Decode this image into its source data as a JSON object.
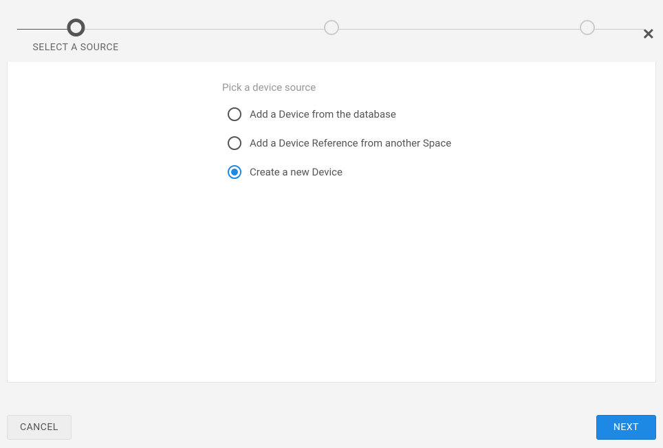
{
  "close_label": "✕",
  "stepper": {
    "steps": [
      {
        "label": "SELECT A SOURCE",
        "active": true
      },
      {
        "label": "",
        "active": false
      },
      {
        "label": "",
        "active": false
      }
    ]
  },
  "content": {
    "section_title": "Pick a device source",
    "options": [
      {
        "label": "Add a Device from the database",
        "selected": false
      },
      {
        "label": "Add a Device Reference from another Space",
        "selected": false
      },
      {
        "label": "Create a new Device",
        "selected": true
      }
    ]
  },
  "footer": {
    "cancel_label": "CANCEL",
    "next_label": "NEXT"
  }
}
